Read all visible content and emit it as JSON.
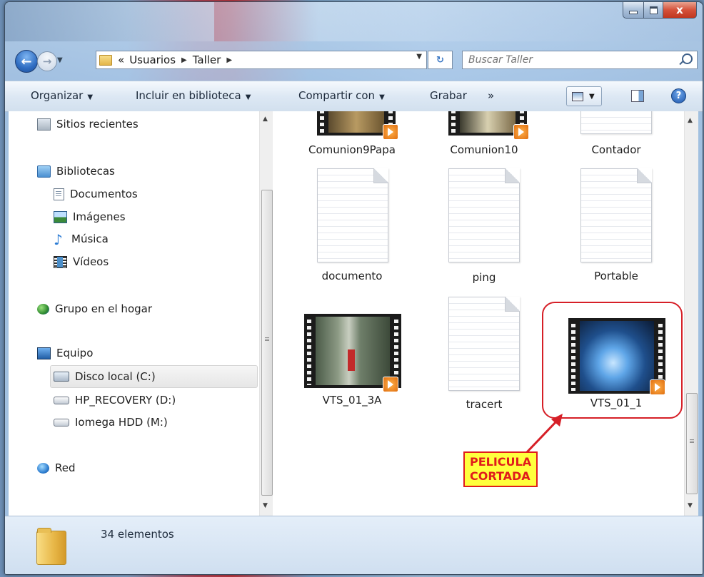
{
  "window": {
    "caption": {
      "minimize_symbol": "",
      "maximize_symbol": "",
      "close_symbol": "x"
    }
  },
  "address": {
    "overflow_marker": "«",
    "crumbs": [
      "Usuarios",
      "Taller"
    ],
    "search_placeholder": "Buscar Taller"
  },
  "toolbar": {
    "organize": "Organizar",
    "include_library": "Incluir en biblioteca",
    "share_with": "Compartir con",
    "burn": "Grabar",
    "more": "»"
  },
  "nav": {
    "recent_places": "Sitios recientes",
    "libraries": "Bibliotecas",
    "documents": "Documentos",
    "images": "Imágenes",
    "music": "Música",
    "videos": "Vídeos",
    "homegroup": "Grupo en el hogar",
    "computer": "Equipo",
    "local_disk": "Disco local (C:)",
    "recovery": "HP_RECOVERY (D:)",
    "iomega": "Iomega HDD (M:)",
    "network": "Red"
  },
  "files": [
    {
      "label": "Comunion9Papa",
      "kind": "video"
    },
    {
      "label": "Comunion10",
      "kind": "video"
    },
    {
      "label": "Contador",
      "kind": "text"
    },
    {
      "label": "documento",
      "kind": "text"
    },
    {
      "label": "ping",
      "kind": "text"
    },
    {
      "label": "Portable",
      "kind": "text"
    },
    {
      "label": "VTS_01_3A",
      "kind": "video"
    },
    {
      "label": "tracert",
      "kind": "text"
    },
    {
      "label": "VTS_01_1",
      "kind": "video"
    }
  ],
  "annotation": {
    "line1": "PELICULA",
    "line2": "CORTADA"
  },
  "status": {
    "count": "34 elementos"
  },
  "colors": {
    "annotation_red": "#d61f27",
    "annotation_yellow": "#ffff3d",
    "window_glass": "#aac8e8"
  }
}
